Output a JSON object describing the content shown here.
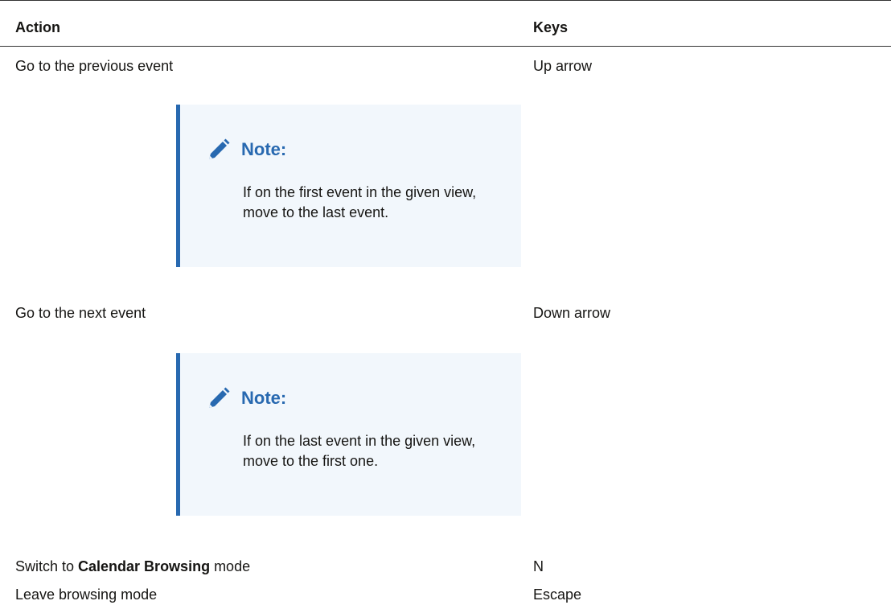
{
  "table": {
    "headers": {
      "action": "Action",
      "keys": "Keys"
    },
    "rows": [
      {
        "action": "Go to the previous event",
        "keys": "Up arrow",
        "note": {
          "title": "Note:",
          "icon": "pencil-icon",
          "text": "If on the first event in the given view, move to the last event."
        }
      },
      {
        "action": "Go to the next event",
        "keys": "Down arrow",
        "note": {
          "title": "Note:",
          "icon": "pencil-icon",
          "text": "If on the last event in the given view, move to the first one."
        }
      },
      {
        "action_prefix": "Switch to ",
        "action_bold": "Calendar Browsing",
        "action_suffix": " mode",
        "keys": "N"
      },
      {
        "action": "Leave browsing mode",
        "keys": "Escape"
      }
    ]
  },
  "colors": {
    "note_accent": "#2869b0",
    "note_background": "#f2f7fc",
    "text": "#161513",
    "rule": "#333333"
  }
}
